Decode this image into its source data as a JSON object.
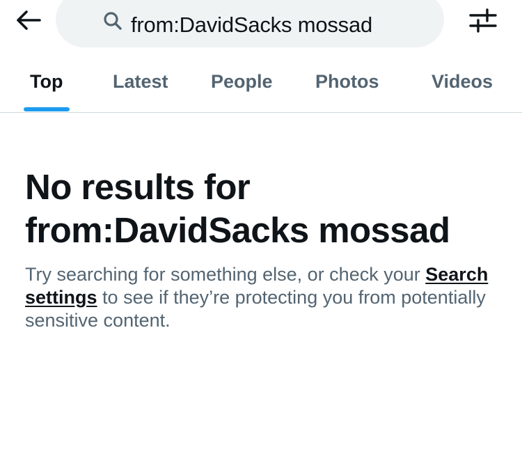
{
  "search": {
    "query": "from:DavidSacks mossad"
  },
  "icons": {
    "back": "arrow-left-icon",
    "search": "magnifier-icon",
    "filter": "sliders-icon"
  },
  "tabs": [
    {
      "label": "Top",
      "active": true
    },
    {
      "label": "Latest",
      "active": false
    },
    {
      "label": "People",
      "active": false
    },
    {
      "label": "Photos",
      "active": false
    },
    {
      "label": "Videos",
      "active": false
    }
  ],
  "empty_state": {
    "title_prefix": "No results for",
    "title_query": "from:DavidSacks mossad",
    "body_before": "Try searching for something else, or check your",
    "link_label": "Search settings",
    "body_after": "to see if they’re protecting you from potentially sensitive content."
  },
  "colors": {
    "text_primary": "#0f1419",
    "text_secondary": "#536471",
    "accent": "#1d9bf0",
    "search_bg": "#eff3f4",
    "divider": "#cfd9de"
  }
}
